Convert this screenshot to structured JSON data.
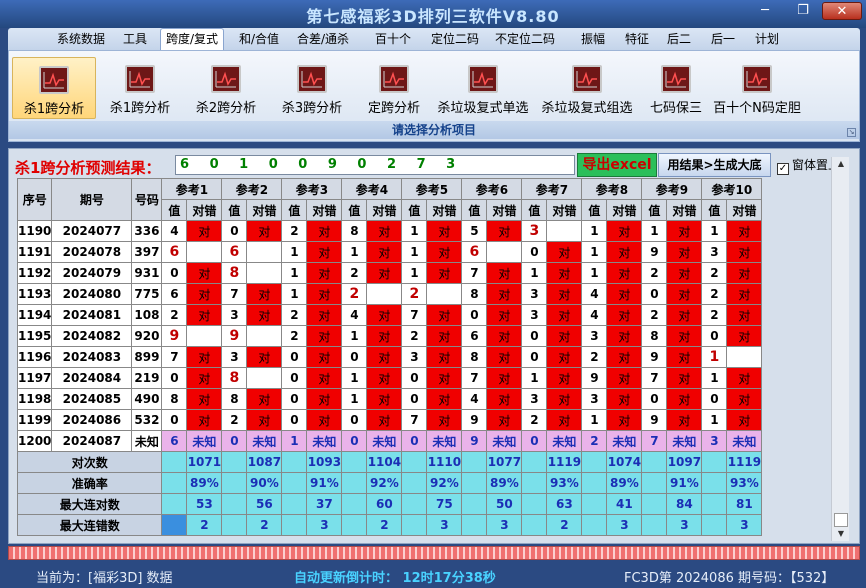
{
  "window": {
    "title": "第七感福彩3D排列三软件V8.80"
  },
  "menu": [
    "系统数据",
    "工具",
    "跨度/复式",
    "和/合值",
    "合差/通杀",
    "百十个",
    "定位二码",
    "不定位二码",
    "振幅",
    "特征",
    "后二",
    "后一",
    "计划"
  ],
  "menu_active": 2,
  "ribbon": {
    "buttons": [
      "杀1跨分析",
      "杀1跨分析",
      "杀2跨分析",
      "杀3跨分析",
      "定跨分析",
      "杀垃圾复式单选",
      "杀垃圾复式组选",
      "七码保三",
      "百十个N码定胆"
    ],
    "selected": 0,
    "caption": "请选择分析项目"
  },
  "prediction": {
    "label": "杀1跨分析预测结果：",
    "value": "6 0 1 0 0 9 0 2 7 3"
  },
  "export_button": "导出excel",
  "generate_button": "用结果>生成大底",
  "pin_checkbox": {
    "label": "窗体置上",
    "checked": true
  },
  "table": {
    "headers": {
      "seq": "序号",
      "issue": "期号",
      "number": "号码",
      "value": "值",
      "result": "对错"
    },
    "refs": [
      "参考1",
      "参考2",
      "参考3",
      "参考4",
      "参考5",
      "参考6",
      "参考7",
      "参考8",
      "参考9",
      "参考10"
    ],
    "rows": [
      {
        "seq": "1190",
        "issue": "2024077",
        "num": "336",
        "vals": [
          "4",
          "0",
          "2",
          "8",
          "1",
          "5",
          "3",
          "1",
          "1",
          "1"
        ],
        "res": [
          "对",
          "对",
          "对",
          "对",
          "对",
          "对",
          "",
          "对",
          "对",
          "对"
        ],
        "hit": [
          false,
          false,
          false,
          false,
          false,
          false,
          true,
          false,
          false,
          false
        ]
      },
      {
        "seq": "1191",
        "issue": "2024078",
        "num": "397",
        "vals": [
          "6",
          "6",
          "1",
          "1",
          "1",
          "6",
          "0",
          "1",
          "9",
          "3"
        ],
        "res": [
          "",
          "",
          "对",
          "对",
          "对",
          "",
          "对",
          "对",
          "对",
          "对"
        ],
        "hit": [
          true,
          true,
          false,
          false,
          false,
          true,
          false,
          false,
          false,
          false
        ]
      },
      {
        "seq": "1192",
        "issue": "2024079",
        "num": "931",
        "vals": [
          "0",
          "8",
          "1",
          "2",
          "1",
          "7",
          "1",
          "1",
          "2",
          "2"
        ],
        "res": [
          "对",
          "",
          "对",
          "对",
          "对",
          "对",
          "对",
          "对",
          "对",
          "对"
        ],
        "hit": [
          false,
          true,
          false,
          false,
          false,
          false,
          false,
          false,
          false,
          false
        ]
      },
      {
        "seq": "1193",
        "issue": "2024080",
        "num": "775",
        "vals": [
          "6",
          "7",
          "1",
          "2",
          "2",
          "8",
          "3",
          "4",
          "0",
          "2"
        ],
        "res": [
          "对",
          "对",
          "对",
          "",
          "",
          "对",
          "对",
          "对",
          "对",
          "对"
        ],
        "hit": [
          false,
          false,
          false,
          true,
          true,
          false,
          false,
          false,
          false,
          false
        ]
      },
      {
        "seq": "1194",
        "issue": "2024081",
        "num": "108",
        "vals": [
          "2",
          "3",
          "2",
          "4",
          "7",
          "0",
          "3",
          "4",
          "2",
          "2"
        ],
        "res": [
          "对",
          "对",
          "对",
          "对",
          "对",
          "对",
          "对",
          "对",
          "对",
          "对"
        ],
        "hit": [
          false,
          false,
          false,
          false,
          false,
          false,
          false,
          false,
          false,
          false
        ]
      },
      {
        "seq": "1195",
        "issue": "2024082",
        "num": "920",
        "vals": [
          "9",
          "9",
          "2",
          "1",
          "2",
          "6",
          "0",
          "3",
          "8",
          "0"
        ],
        "res": [
          "",
          "",
          "对",
          "对",
          "对",
          "对",
          "对",
          "对",
          "对",
          "对"
        ],
        "hit": [
          true,
          true,
          false,
          false,
          false,
          false,
          false,
          false,
          false,
          false
        ]
      },
      {
        "seq": "1196",
        "issue": "2024083",
        "num": "899",
        "vals": [
          "7",
          "3",
          "0",
          "0",
          "3",
          "8",
          "0",
          "2",
          "9",
          "1"
        ],
        "res": [
          "对",
          "对",
          "对",
          "对",
          "对",
          "对",
          "对",
          "对",
          "对",
          ""
        ],
        "hit": [
          false,
          false,
          false,
          false,
          false,
          false,
          false,
          false,
          false,
          true
        ]
      },
      {
        "seq": "1197",
        "issue": "2024084",
        "num": "219",
        "vals": [
          "0",
          "8",
          "0",
          "1",
          "0",
          "7",
          "1",
          "9",
          "7",
          "1"
        ],
        "res": [
          "对",
          "",
          "对",
          "对",
          "对",
          "对",
          "对",
          "对",
          "对",
          "对"
        ],
        "hit": [
          false,
          true,
          false,
          false,
          false,
          false,
          false,
          false,
          false,
          false
        ]
      },
      {
        "seq": "1198",
        "issue": "2024085",
        "num": "490",
        "vals": [
          "8",
          "8",
          "0",
          "1",
          "0",
          "4",
          "3",
          "3",
          "0",
          "0"
        ],
        "res": [
          "对",
          "对",
          "对",
          "对",
          "对",
          "对",
          "对",
          "对",
          "对",
          "对"
        ],
        "hit": [
          false,
          false,
          false,
          false,
          false,
          false,
          false,
          false,
          false,
          false
        ]
      },
      {
        "seq": "1199",
        "issue": "2024086",
        "num": "532",
        "vals": [
          "0",
          "2",
          "0",
          "0",
          "7",
          "9",
          "2",
          "1",
          "9",
          "1"
        ],
        "res": [
          "对",
          "对",
          "对",
          "对",
          "对",
          "对",
          "对",
          "对",
          "对",
          "对"
        ],
        "hit": [
          false,
          false,
          false,
          false,
          false,
          false,
          false,
          false,
          false,
          false
        ]
      }
    ],
    "last_row": {
      "seq": "1200",
      "issue": "2024087",
      "num": "未知",
      "vals": [
        "6",
        "0",
        "1",
        "0",
        "0",
        "9",
        "0",
        "2",
        "7",
        "3"
      ],
      "res": "未知"
    },
    "stats": [
      {
        "label": "对次数",
        "values": [
          "1071",
          "1087",
          "1093",
          "1104",
          "1110",
          "1077",
          "1119",
          "1074",
          "1097",
          "1119"
        ]
      },
      {
        "label": "准确率",
        "values": [
          "89%",
          "90%",
          "91%",
          "92%",
          "92%",
          "89%",
          "93%",
          "89%",
          "91%",
          "93%"
        ]
      },
      {
        "label": "最大连对数",
        "values": [
          "53",
          "56",
          "37",
          "60",
          "75",
          "50",
          "63",
          "41",
          "84",
          "81"
        ]
      },
      {
        "label": "最大连错数",
        "values": [
          "2",
          "2",
          "3",
          "2",
          "3",
          "3",
          "2",
          "3",
          "3",
          "3"
        ]
      }
    ]
  },
  "status": {
    "left": "当前为：[福彩3D] 数据",
    "center": "自动更新倒计时：  12时17分38秒",
    "right": "FC3D第 2024086 期号码：【532】"
  }
}
